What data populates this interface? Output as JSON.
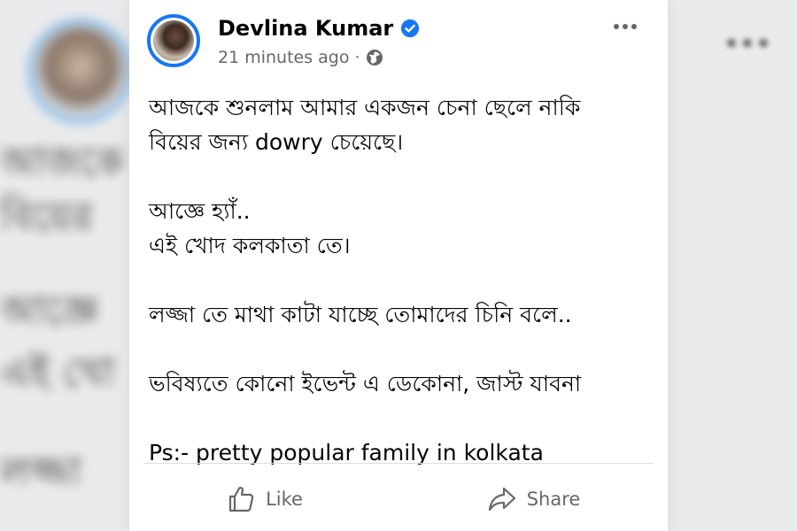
{
  "post": {
    "author": "Devlina Kumar",
    "time": "21 minutes ago",
    "separator": "·",
    "lines": [
      "আজকে শুনলাম আমার একজন চেনা ছেলে নাকি",
      "বিয়ের জন্য dowry চেয়েছে।",
      "",
      "আজ্ঞে হ্যাঁ..",
      "এই খোদ কলকাতা তে।",
      "",
      "লজ্জা তে মাথা কাটা যাচ্ছে তোমাদের চিনি বলে..",
      "",
      "ভবিষ্যতে কোনো ইভেন্ট এ ডেকোনা, জাস্ট যাবনা",
      "",
      "Ps:- pretty popular family in kolkata"
    ]
  },
  "actions": {
    "like_label": "Like",
    "share_label": "Share"
  },
  "icons": {
    "verified": "verified-badge-icon",
    "privacy": "globe-icon",
    "more": "more-options-icon",
    "like": "thumbs-up-icon",
    "share": "share-arrow-icon"
  },
  "colors": {
    "verified_blue": "#1877f2",
    "secondary_text": "#65676b",
    "primary_text": "#050505",
    "card_background": "#ffffff"
  },
  "background": {
    "blurred_lines": [
      "আজকে",
      "বিয়ের",
      "আজ্ঞে",
      "এই খো",
      "লজ্জা"
    ]
  }
}
